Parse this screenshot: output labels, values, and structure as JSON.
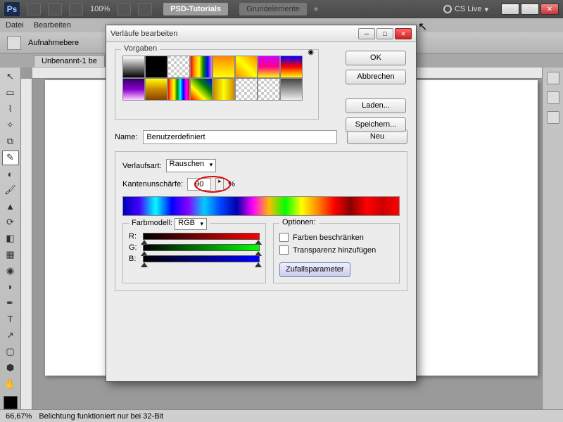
{
  "app": {
    "logo": "Ps",
    "zoom": "100%",
    "tab1": "PSD-Tutorials",
    "tab2": "Grundelemente",
    "cslive": "CS Live"
  },
  "menu": [
    "Datei",
    "Bearbeiten"
  ],
  "optbar": {
    "label": "Aufnahmebere"
  },
  "doctab": "Unbenannt-1 be",
  "status": {
    "zoom": "66,67%",
    "msg": "Belichtung funktioniert nur bei 32-Bit"
  },
  "dialog": {
    "title": "Verläufe bearbeiten",
    "presets_label": "Vorgaben",
    "buttons": {
      "ok": "OK",
      "cancel": "Abbrechen",
      "load": "Laden...",
      "save": "Speichern...",
      "new": "Neu"
    },
    "name_label": "Name:",
    "name_value": "Benutzerdefiniert",
    "type_label": "Verlaufsart:",
    "type_value": "Rauschen",
    "rough_label": "Kantenunschärfe:",
    "rough_value": "90",
    "rough_unit": "%",
    "colormodel_label": "Farbmodell:",
    "colormodel_value": "RGB",
    "channels": {
      "r": "R:",
      "g": "G:",
      "b": "B:"
    },
    "options_label": "Optionen:",
    "opt1": "Farben beschränken",
    "opt2": "Transparenz hinzufügen",
    "random": "Zufallsparameter"
  }
}
